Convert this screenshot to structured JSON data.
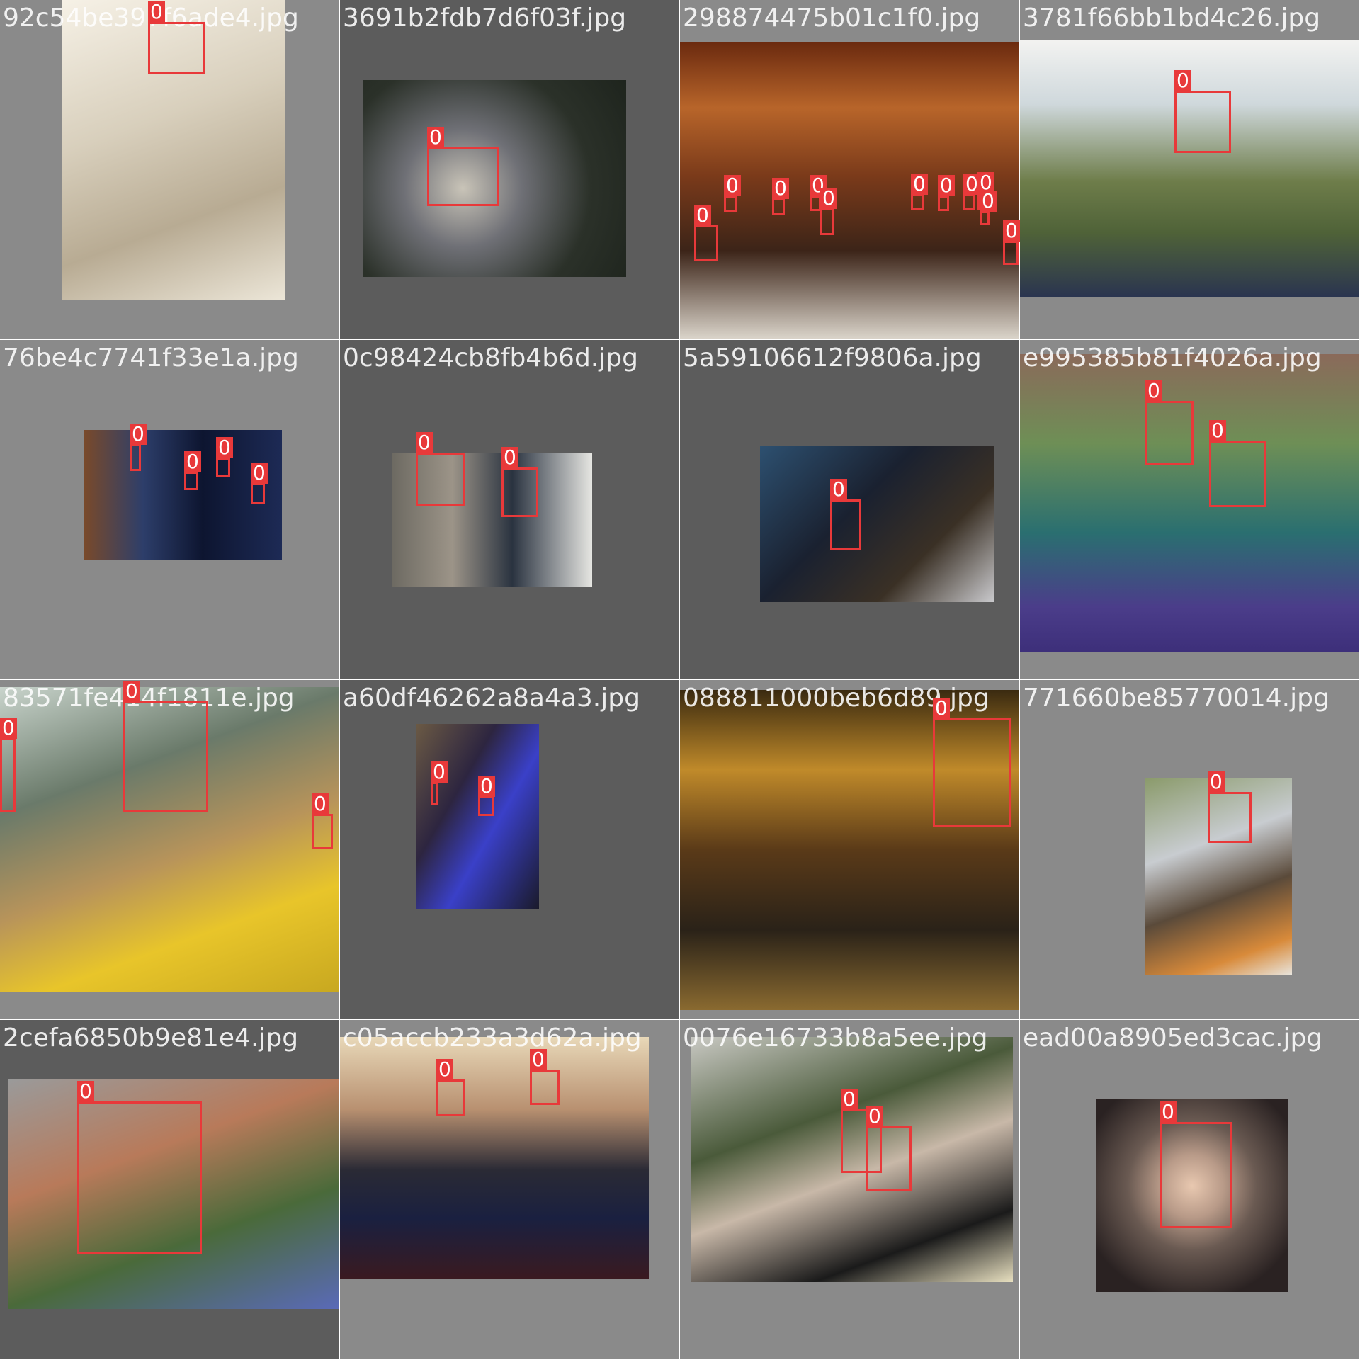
{
  "colors": {
    "box": "#e8393a",
    "tile_light": "#8a8a8a",
    "tile_dark": "#5c5c5c",
    "label_text": "#ffffff"
  },
  "label": "0",
  "tiles": [
    {
      "filename": "92c54be397f6ade4.jpg",
      "detections": 1
    },
    {
      "filename": "3691b2fdb7d6f03f.jpg",
      "detections": 1
    },
    {
      "filename": "298874475b01c1f0.jpg",
      "detections": 11
    },
    {
      "filename": "3781f66bb1bd4c26.jpg",
      "detections": 1
    },
    {
      "filename": "76be4c7741f33e1a.jpg",
      "detections": 4
    },
    {
      "filename": "0c98424cb8fb4b6d.jpg",
      "detections": 2
    },
    {
      "filename": "5a59106612f9806a.jpg",
      "detections": 1
    },
    {
      "filename": "e995385b81f4026a.jpg",
      "detections": 2
    },
    {
      "filename": "83571fe414f1811e.jpg",
      "detections": 3
    },
    {
      "filename": "a60df46262a8a4a3.jpg",
      "detections": 2
    },
    {
      "filename": "088811000beb6d89.jpg",
      "detections": 1
    },
    {
      "filename": "771660be85770014.jpg",
      "detections": 1
    },
    {
      "filename": "2cefa6850b9e81e4.jpg",
      "detections": 1
    },
    {
      "filename": "c05accb233a3d62a.jpg",
      "detections": 2
    },
    {
      "filename": "0076e16733b8a5ee.jpg",
      "detections": 2
    },
    {
      "filename": "ead00a8905ed3cac.jpg",
      "detections": 1
    }
  ]
}
